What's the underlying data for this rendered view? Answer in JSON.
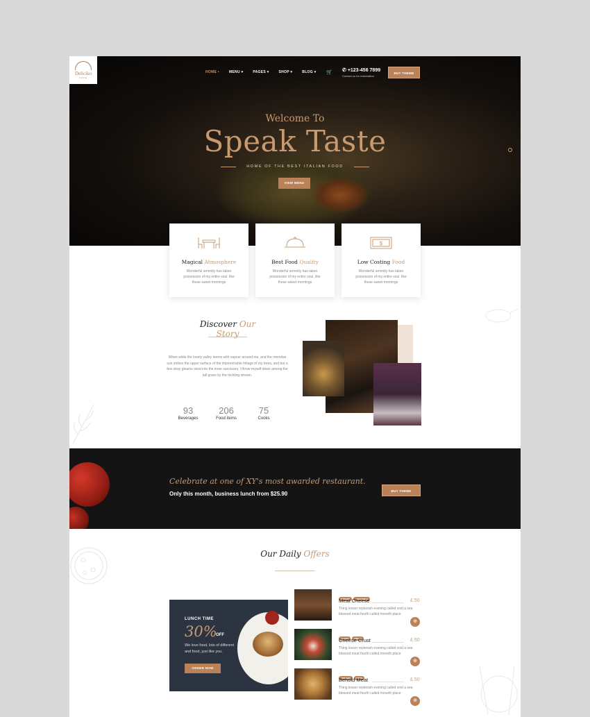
{
  "logo": {
    "name": "Deliciko",
    "sub": "CAFE"
  },
  "nav": {
    "items": [
      {
        "label": "HOME",
        "suffix": " •"
      },
      {
        "label": "MENU",
        "suffix": " ▾"
      },
      {
        "label": "PAGES",
        "suffix": " ▾"
      },
      {
        "label": "SHOP",
        "suffix": " ▾"
      },
      {
        "label": "BLOG",
        "suffix": " ▾"
      }
    ]
  },
  "header": {
    "phone": "+123-456 7899",
    "phone_sub": "Contact us for reservation",
    "buy_label": "BUY THEME"
  },
  "hero": {
    "welcome": "Welcome To",
    "title": "Speak Taste",
    "tagline": "HOME OF THE BEST ITALIAN FOOD",
    "button": "VIEW MENU"
  },
  "features": [
    {
      "title_main": "Magical ",
      "title_accent": "Atmosphere",
      "text": "Wonderful serenity has taken possession of my entire soul, like these sweet mornings"
    },
    {
      "title_main": "Best Food ",
      "title_accent": "Quality",
      "text": "Wonderful serenity has taken possession of my entire soul, like these sweet mornings"
    },
    {
      "title_main": "Low Costing ",
      "title_accent": "Food",
      "text": "Wonderful serenity has taken possession of my entire soul, like these sweet mornings"
    }
  ],
  "story": {
    "title_main": "Discover ",
    "title_accent": "Our Story",
    "text": "When while the lovely valley teems with vapour around me, and the meridian sun strikes the upper surface of the impenetrable foliage of my trees, and but a few stray gleams steal into the inner sanctuary, I throw myself down among the tall grass by the trickling stream.",
    "stats": [
      {
        "number": "93",
        "label": "Beverages"
      },
      {
        "number": "206",
        "label": "Food items"
      },
      {
        "number": "75",
        "label": "Cooks"
      }
    ]
  },
  "banner": {
    "script": "Celebrate at one of XY's most awarded restaurant.",
    "sub": "Only this month, business lunch from $25.90",
    "button": "BUY THEME"
  },
  "offers": {
    "title_main": "Our Daily ",
    "title_accent": "Offers",
    "lunch": {
      "label": "LUNCH TIME",
      "percent": "30%",
      "off": "OFF",
      "desc": "We love food, lots of different and food, just like you.",
      "button": "ORDER NOW"
    },
    "items": [
      {
        "tags": [
          "BURGER",
          "VEGETABLE"
        ],
        "name": "Meat Cheese",
        "price": "£ 50",
        "desc": "Thing lesser replenish evening called void a sea blessed meat fourth called moveth place"
      },
      {
        "tags": [
          "BREAD",
          "CREAM"
        ],
        "name": "Cheese Crust",
        "price": "£ 50",
        "desc": "Thing lesser replenish evening called void a sea blessed meat fourth called moveth place"
      },
      {
        "tags": [
          "CHICKEN",
          "PASTA"
        ],
        "name": "Behold Meat",
        "price": "£ 50",
        "desc": "Thing lesser replenish evening called void a sea blessed meat fourth called moveth place"
      }
    ]
  },
  "colors": {
    "accent": "#c69b73",
    "button": "#b98259",
    "dark": "#151414"
  }
}
